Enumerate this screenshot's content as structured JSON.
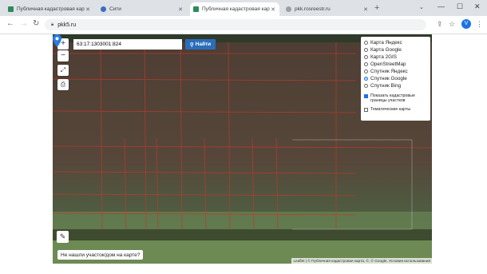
{
  "tabs": [
    {
      "title": "Публичная кадастровая карта",
      "active": false,
      "favicon_color": "#2e8b57"
    },
    {
      "title": "Сити",
      "active": false,
      "favicon_color": "#3b6ec2"
    },
    {
      "title": "Публичная кадастровая карта",
      "active": true,
      "favicon_color": "#2e8b57"
    },
    {
      "title": "pkk.rosreestr.ru",
      "active": false,
      "favicon_color": "#9aa0a6"
    }
  ],
  "toolbar": {
    "url": "pkk5.ru",
    "avatar": "V"
  },
  "map": {
    "search_value": "63:17:1303001:824",
    "search_button": "Найти",
    "zoom_in": "+",
    "zoom_out": "−",
    "layers": [
      {
        "label": "Карта Яндекс",
        "selected": false
      },
      {
        "label": "Карта Google",
        "selected": false
      },
      {
        "label": "Карта 2GIS",
        "selected": false
      },
      {
        "label": "OpenStreetMap",
        "selected": false
      },
      {
        "label": "Спутник Яндекс",
        "selected": false
      },
      {
        "label": "Спутник Google",
        "selected": true
      },
      {
        "label": "Спутник Bing",
        "selected": false
      }
    ],
    "option_borders": "Показать кадастровые границы участков",
    "option_thematic": "Тематические карты",
    "not_found": "Не нашли участок/дом на карте?",
    "attribution": "Leaflet | © Публичная кадастровая карта, ©, © Google, Условия использования",
    "parcel_labels": [
      "",
      "",
      "",
      "",
      "",
      "",
      "",
      "",
      "",
      "",
      "",
      "",
      "",
      "",
      "",
      "",
      "",
      "",
      "",
      "",
      "",
      "",
      "",
      "",
      "",
      "",
      "",
      ""
    ]
  }
}
